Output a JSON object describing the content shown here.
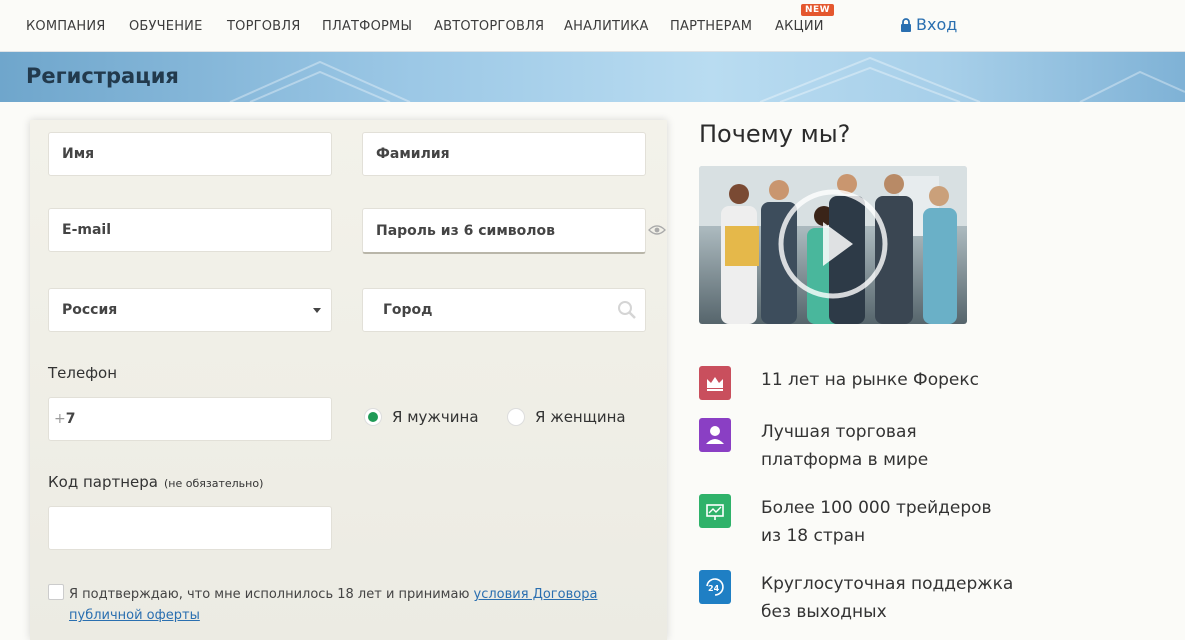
{
  "nav": {
    "items": [
      "КОМПАНИЯ",
      "ОБУЧЕНИЕ",
      "ТОРГОВЛЯ",
      "ПЛАТФОРМЫ",
      "АВТОТОРГОВЛЯ",
      "АНАЛИТИКА",
      "ПАРТНЕРАМ",
      "АКЦИИ"
    ],
    "new_badge": "NEW",
    "login_label": "Вход"
  },
  "banner": {
    "title": "Регистрация"
  },
  "form": {
    "first_name_placeholder": "Имя",
    "last_name_placeholder": "Фамилия",
    "email_placeholder": "E-mail",
    "password_placeholder": "Пароль из 6 символов",
    "country_value": "Россия",
    "city_placeholder": "Город",
    "phone_label": "Телефон",
    "phone_prefix": "+",
    "phone_value": "7",
    "gender_male": "Я мужчина",
    "gender_female": "Я женщина",
    "gender_selected": "male",
    "partner_label": "Код партнера",
    "partner_optional": "(не обязательно)",
    "consent_text": "Я подтверждаю, что мне исполнилось 18 лет и принимаю ",
    "consent_link": "условия Договора публичной оферты"
  },
  "why": {
    "title": "Почему мы?",
    "features": [
      {
        "icon": "crown-icon",
        "color": "#c94f5d",
        "line1": "11 лет на рынке Форекс",
        "line2": ""
      },
      {
        "icon": "user-icon",
        "color": "#8a3fc4",
        "line1": "Лучшая торговая",
        "line2": "платформа в мире"
      },
      {
        "icon": "presentation-icon",
        "color": "#2fb26a",
        "line1": "Более 100 000 трейдеров",
        "line2": "из 18 стран"
      },
      {
        "icon": "support-24-icon",
        "color": "#1f7fc4",
        "line1": "Круглосуточная поддержка",
        "line2": "без выходных"
      }
    ]
  }
}
